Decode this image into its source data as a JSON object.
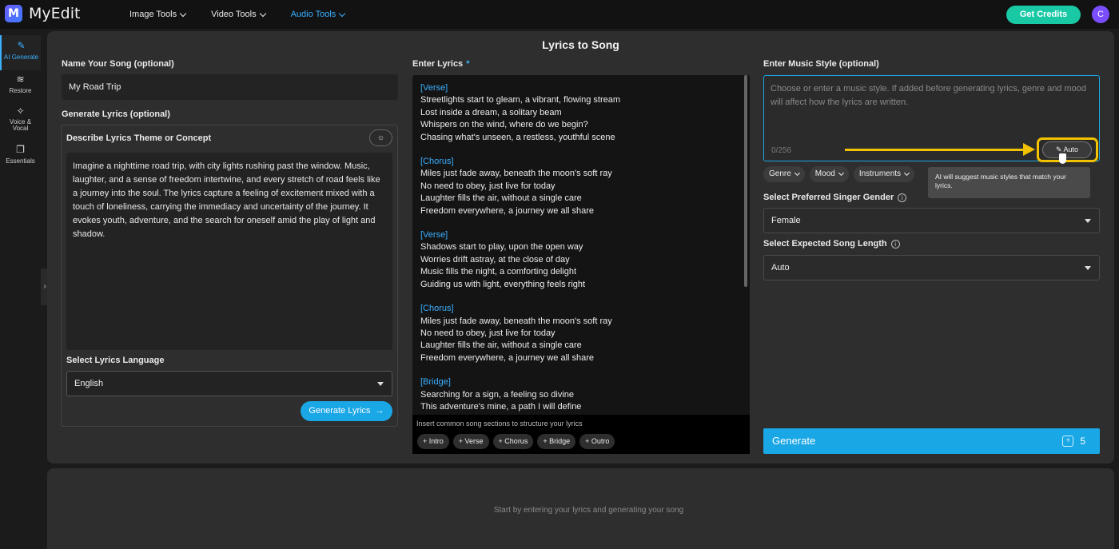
{
  "app": {
    "name": "MyEdit",
    "logo_letter": "M"
  },
  "nav": {
    "items": [
      "Image Tools",
      "Video Tools",
      "Audio Tools"
    ],
    "active": "Audio Tools"
  },
  "header": {
    "credits_label": "Get Credits",
    "avatar_letter": "C"
  },
  "sidebar": {
    "items": [
      {
        "label": "AI Generate",
        "icon": "magic-wand-icon"
      },
      {
        "label": "Restore",
        "icon": "waveform-icon"
      },
      {
        "label": "Voice & Vocal",
        "icon": "voice-wand-icon"
      },
      {
        "label": "Essentials",
        "icon": "layers-icon"
      }
    ]
  },
  "page": {
    "title": "Lyrics to Song"
  },
  "left": {
    "name_label": "Name Your Song (optional)",
    "name_value": "My Road Trip",
    "generate_label": "Generate Lyrics (optional)",
    "theme_label": "Describe Lyrics Theme or Concept",
    "theme_text": "Imagine a nighttime road trip, with city lights rushing past the window. Music, laughter, and a sense of freedom intertwine, and every stretch of road feels like a journey into the soul. The lyrics capture a feeling of excitement mixed with a touch of loneliness, carrying the immediacy and uncertainty of the journey. It evokes youth, adventure, and the search for oneself amid the play of light and shadow.",
    "language_label": "Select Lyrics Language",
    "language_value": "English",
    "generate_lyrics_button": "Generate Lyrics"
  },
  "lyrics": {
    "label": "Enter Lyrics",
    "required_mark": "*",
    "blocks": [
      {
        "tag": "[Verse]",
        "lines": [
          "Streetlights start to gleam, a vibrant, flowing stream",
          "Lost inside a dream, a solitary beam",
          "Whispers on the wind, where do we begin?",
          "Chasing what's unseen, a restless, youthful scene"
        ]
      },
      {
        "tag": "[Chorus]",
        "lines": [
          "Miles just fade away, beneath the moon's soft ray",
          "No need to obey, just live for today",
          "Laughter fills the air, without a single care",
          "Freedom everywhere, a journey we all share"
        ]
      },
      {
        "tag": "[Verse]",
        "lines": [
          "Shadows start to play, upon the open way",
          "Worries drift astray, at the close of day",
          "Music fills the night, a comforting delight",
          "Guiding us with light, everything feels right"
        ]
      },
      {
        "tag": "[Chorus]",
        "lines": [
          "Miles just fade away, beneath the moon's soft ray",
          "No need to obey, just live for today",
          "Laughter fills the air, without a single care",
          "Freedom everywhere, a journey we all share"
        ]
      },
      {
        "tag": "[Bridge]",
        "lines": [
          "Searching for a sign, a feeling so divine",
          "This adventure's mine, a path I will define"
        ]
      }
    ],
    "sections_hint": "Insert common song sections to structure your lyrics",
    "section_chips": [
      "+ Intro",
      "+ Verse",
      "+ Chorus",
      "+ Bridge",
      "+ Outro"
    ]
  },
  "right": {
    "style_label": "Enter Music Style (optional)",
    "style_placeholder": "Choose or enter a music style. If added before generating lyrics, genre and mood will affect how the lyrics are written.",
    "counter": "0/256",
    "auto_button": "Auto",
    "filters": [
      "Genre",
      "Mood",
      "Instruments"
    ],
    "tooltip": "AI will suggest music styles that match your lyrics.",
    "gender_label": "Select Preferred Singer Gender",
    "gender_value": "Female",
    "length_label": "Select Expected Song Length",
    "length_value": "Auto",
    "generate_button": "Generate",
    "generate_cost": "5"
  },
  "footer": {
    "hint": "Start by entering your lyrics and generating your song"
  },
  "colors": {
    "accent": "#1aa7e6",
    "highlight": "#f2c200",
    "credits": "#19c9a6",
    "avatar": "#7a4dff"
  }
}
